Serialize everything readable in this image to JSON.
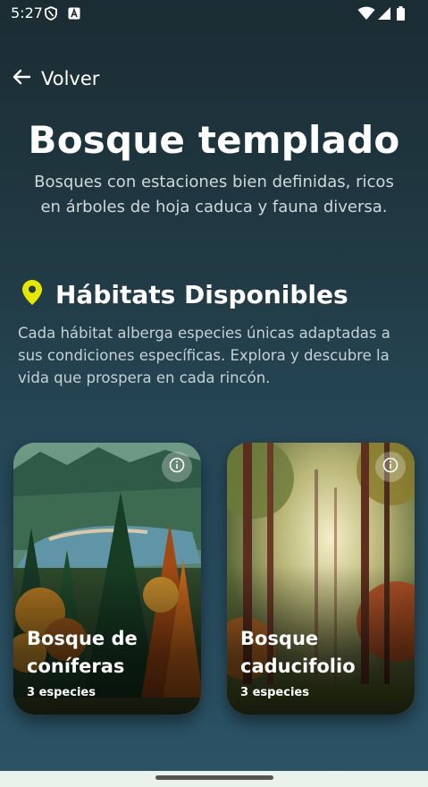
{
  "status_bar": {
    "time": "5:27"
  },
  "header": {
    "back_label": "Volver"
  },
  "hero": {
    "title": "Bosque templado",
    "subtitle": "Bosques con estaciones bien definidas, ricos en árboles de hoja caduca y fauna diversa."
  },
  "habitats_section": {
    "title": "Hábitats Disponibles",
    "description": "Cada hábitat alberga especies únicas adaptadas a sus condiciones específicas. Explora y descubre la vida que prospera en cada rincón.",
    "icon": "location-pin-icon",
    "icon_color": "#e6e600",
    "cards": [
      {
        "title": "Bosque de coníferas",
        "count": "3 especies"
      },
      {
        "title": "Bosque caducifolio",
        "count": "3 especies"
      }
    ]
  },
  "colors": {
    "background_top": "#1b2c33",
    "background_bottom": "#2b5366",
    "nav_bar": "#e9f3ec"
  }
}
